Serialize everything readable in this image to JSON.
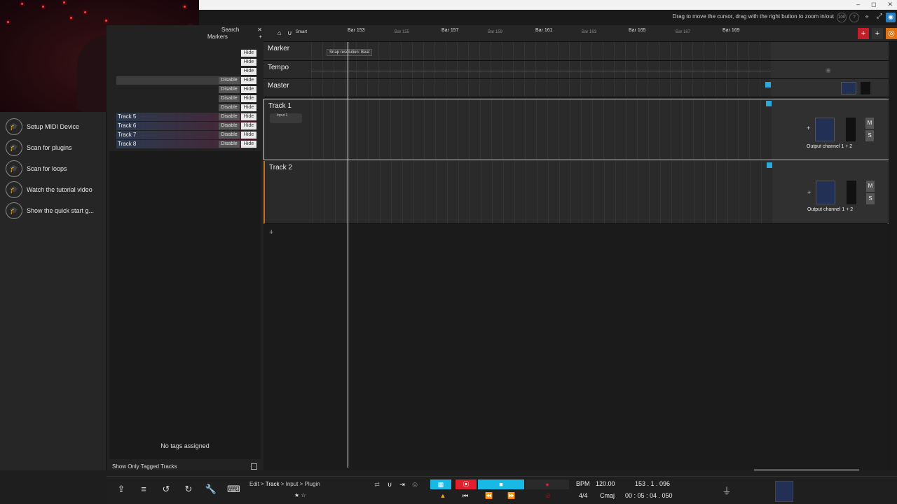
{
  "window": {
    "hint": "Drag to move the cursor, drag with the right button to zoom in/out",
    "zoom_badge": "100",
    "controls": [
      "–",
      "◻",
      "✕"
    ]
  },
  "left_panel": {
    "items": [
      {
        "label": "Setup MIDI Device",
        "icon": "graduation-cap-icon"
      },
      {
        "label": "Scan for plugins",
        "icon": "graduation-cap-icon"
      },
      {
        "label": "Scan for loops",
        "icon": "graduation-cap-icon"
      },
      {
        "label": "Watch the tutorial video",
        "icon": "graduation-cap-icon"
      },
      {
        "label": "Show the quick start g...",
        "icon": "graduation-cap-icon"
      }
    ]
  },
  "track_panel": {
    "search_label": "Search",
    "markers_label": "Markers",
    "rows": [
      {
        "name": "",
        "disable": "",
        "hide": "Hide"
      },
      {
        "name": "",
        "disable": "",
        "hide": "Hide"
      },
      {
        "name": "",
        "disable": "",
        "hide": "Hide"
      },
      {
        "name": "",
        "disable": "Disable",
        "hide": "Hide"
      },
      {
        "name": "",
        "disable": "Disable",
        "hide": "Hide"
      },
      {
        "name": "",
        "disable": "Disable",
        "hide": "Hide"
      },
      {
        "name": "",
        "disable": "Disable",
        "hide": "Hide"
      },
      {
        "name": "Track 5",
        "disable": "Disable",
        "hide": "Hide"
      },
      {
        "name": "Track 6",
        "disable": "Disable",
        "hide": "Hide"
      },
      {
        "name": "Track 7",
        "disable": "Disable",
        "hide": "Hide"
      },
      {
        "name": "Track 8",
        "disable": "Disable",
        "hide": "Hide"
      }
    ],
    "no_tags": "No tags assigned",
    "show_tagged": "Show Only Tagged Tracks"
  },
  "ruler": {
    "smart_label": "Smart",
    "major_bars": [
      "Bar 153",
      "Bar 157",
      "Bar 161",
      "Bar 165",
      "Bar 169"
    ],
    "minor_bars": [
      "Bar 155",
      "Bar 159",
      "Bar 163",
      "Bar 167"
    ]
  },
  "arrange": {
    "snap_tip": "Snap resolution: Beat",
    "lanes": {
      "marker": "Marker",
      "tempo": "Tempo",
      "master": "Master",
      "track1": "Track 1",
      "track2": "Track 2"
    },
    "input_label": "Input 1",
    "track1_output": "Output channel 1 + 2",
    "track2_output": "Output channel 1 + 2",
    "mute": "M",
    "solo": "S",
    "add": "+"
  },
  "transport": {
    "crumb": {
      "edit": "Edit",
      "track": "Track",
      "input": "Input",
      "plugin": "Plugin"
    },
    "bpm_label": "BPM",
    "bpm_value": "120.00",
    "position": "153 . 1 . 096",
    "time_sig": "4/4",
    "key": "Cmaj",
    "time": "00 : 05 : 04 . 050"
  },
  "colors": {
    "accent_cyan": "#19b9e6",
    "record_red": "#e0202c",
    "lane_highlight_orange": "#c07020"
  }
}
